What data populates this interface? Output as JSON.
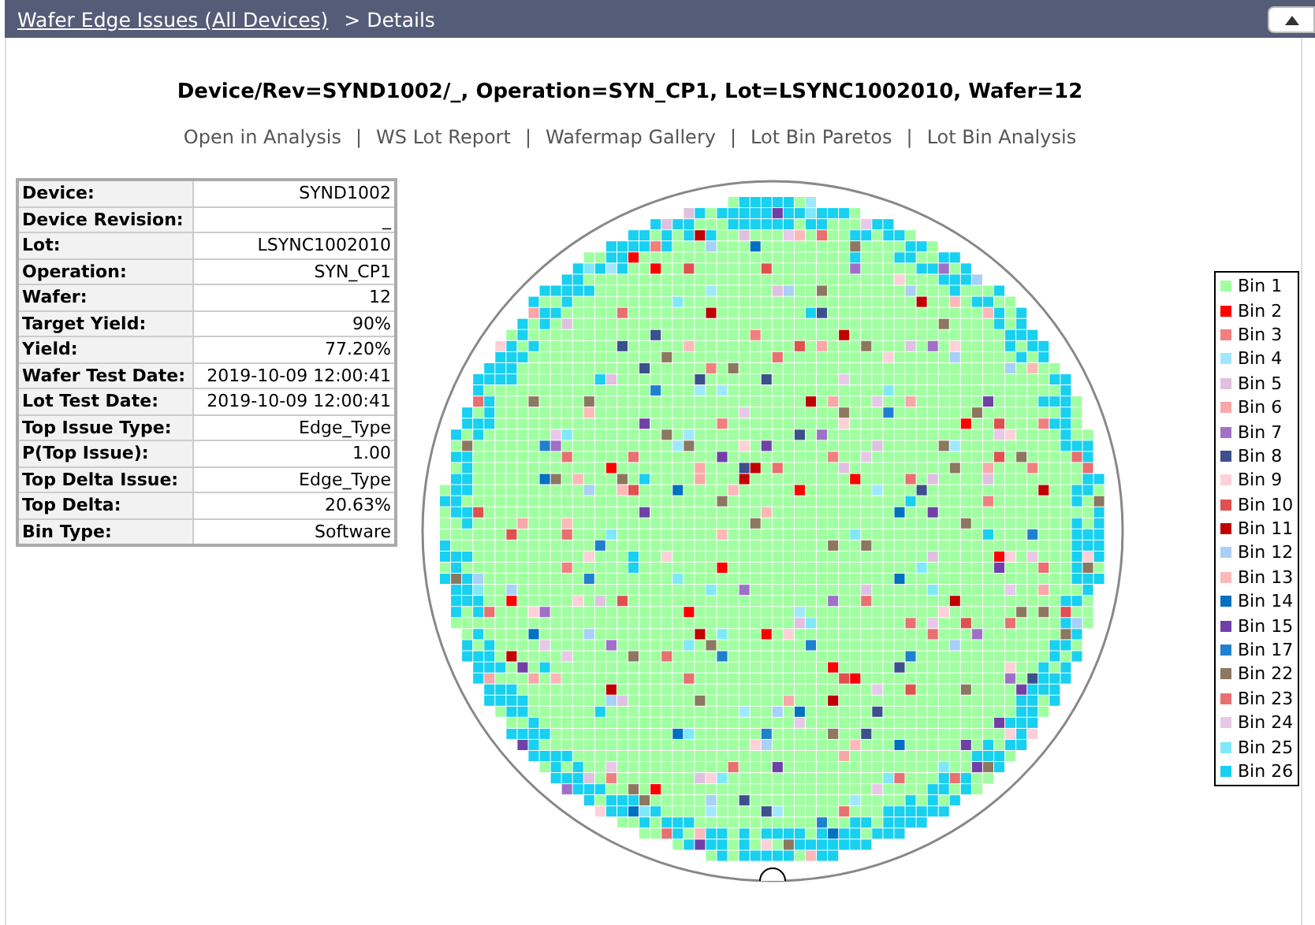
{
  "breadcrumb": {
    "link": "Wafer Edge Issues (All Devices)",
    "current": "> Details"
  },
  "title": "Device/Rev=SYND1002/_, Operation=SYN_CP1, Lot=LSYNC1002010, Wafer=12",
  "links": [
    "Open in Analysis",
    "WS Lot Report",
    "Wafermap Gallery",
    "Lot Bin Paretos",
    "Lot Bin Analysis"
  ],
  "separator": "|",
  "details": [
    {
      "label": "Device:",
      "value": "SYND1002"
    },
    {
      "label": "Device Revision:",
      "value": "_"
    },
    {
      "label": "Lot:",
      "value": "LSYNC1002010"
    },
    {
      "label": "Operation:",
      "value": "SYN_CP1"
    },
    {
      "label": "Wafer:",
      "value": "12"
    },
    {
      "label": "Target Yield:",
      "value": "90%"
    },
    {
      "label": "Yield:",
      "value": "77.20%"
    },
    {
      "label": "Wafer Test Date:",
      "value": "2019-10-09 12:00:41"
    },
    {
      "label": "Lot Test Date:",
      "value": "2019-10-09 12:00:41"
    },
    {
      "label": "Top Issue Type:",
      "value": "Edge_Type"
    },
    {
      "label": "P(Top Issue):",
      "value": "1.00"
    },
    {
      "label": "Top Delta Issue:",
      "value": "Edge_Type"
    },
    {
      "label": "Top Delta:",
      "value": "20.63%"
    },
    {
      "label": "Bin Type:",
      "value": "Software"
    }
  ],
  "legend": [
    {
      "label": "Bin 1",
      "color": "#a0ffa0"
    },
    {
      "label": "Bin 2",
      "color": "#ff0000"
    },
    {
      "label": "Bin 3",
      "color": "#f08080"
    },
    {
      "label": "Bin 4",
      "color": "#a0e8ff"
    },
    {
      "label": "Bin 5",
      "color": "#e0c0e0"
    },
    {
      "label": "Bin 6",
      "color": "#f8a8a8"
    },
    {
      "label": "Bin 7",
      "color": "#a070c8"
    },
    {
      "label": "Bin 8",
      "color": "#3c508c"
    },
    {
      "label": "Bin 9",
      "color": "#ffd0d8"
    },
    {
      "label": "Bin 10",
      "color": "#e05050"
    },
    {
      "label": "Bin 11",
      "color": "#c00000"
    },
    {
      "label": "Bin 12",
      "color": "#a8d0f8"
    },
    {
      "label": "Bin 13",
      "color": "#ffb8b8"
    },
    {
      "label": "Bin 14",
      "color": "#0070c0"
    },
    {
      "label": "Bin 15",
      "color": "#7040a8"
    },
    {
      "label": "Bin 17",
      "color": "#2080d0"
    },
    {
      "label": "Bin 22",
      "color": "#8c7860"
    },
    {
      "label": "Bin 23",
      "color": "#e87070"
    },
    {
      "label": "Bin 24",
      "color": "#e8c8e8"
    },
    {
      "label": "Bin 25",
      "color": "#80e8f8"
    },
    {
      "label": "Bin 26",
      "color": "#18d0f0"
    }
  ]
}
